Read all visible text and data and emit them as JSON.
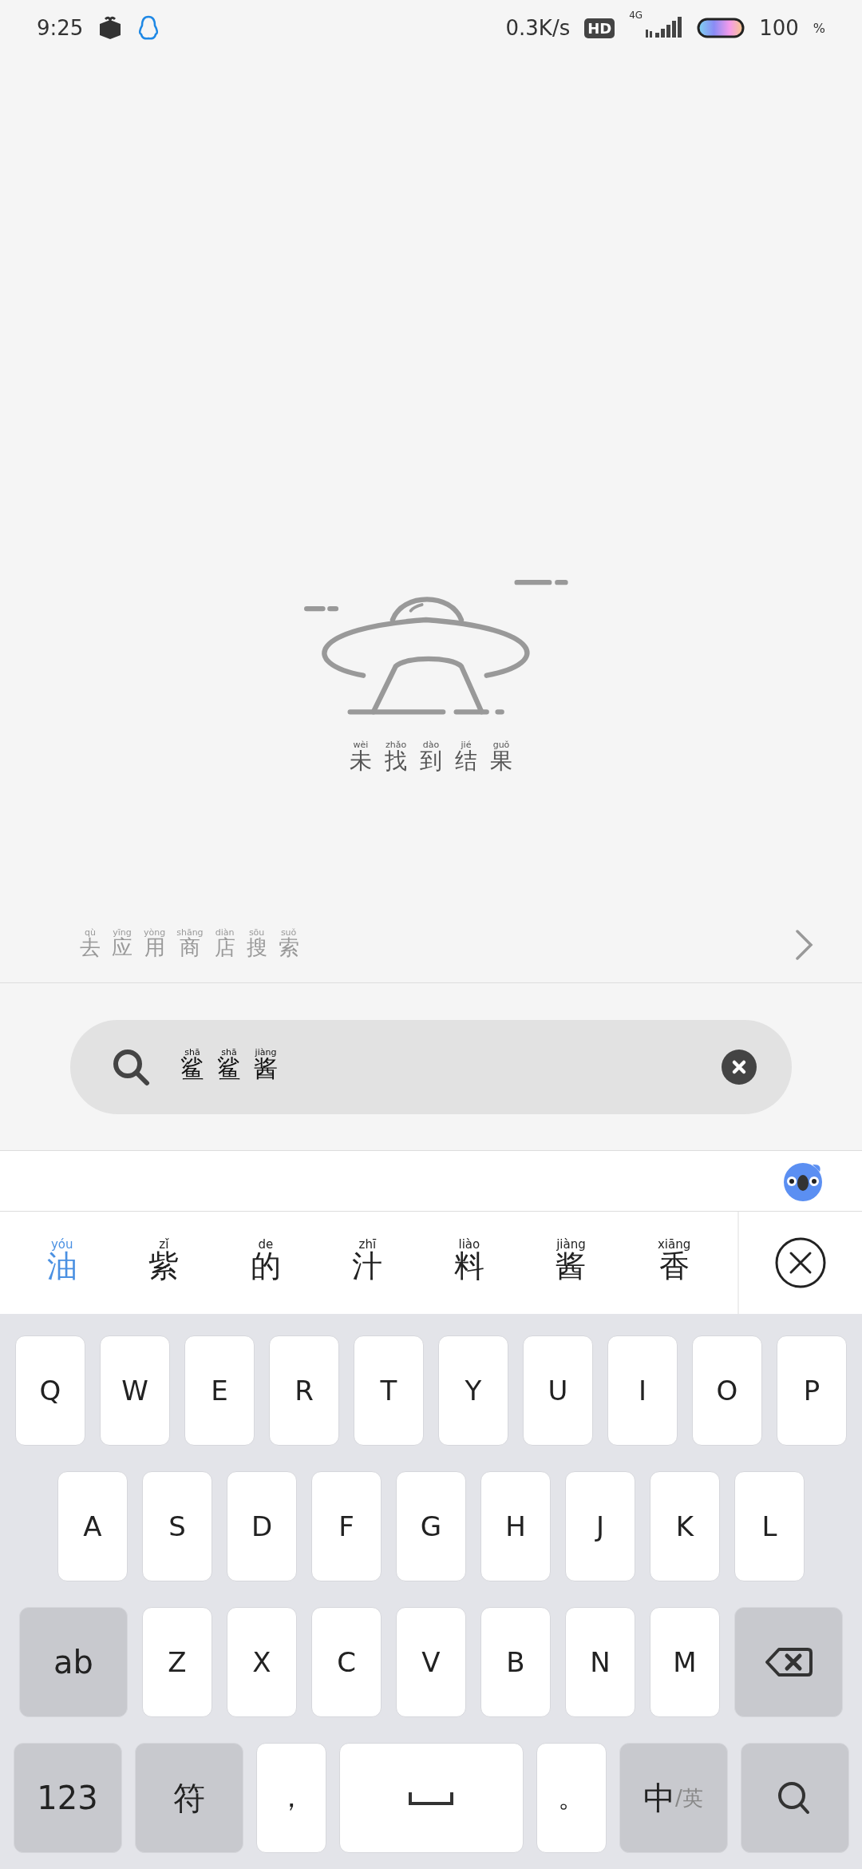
{
  "status_bar": {
    "time": "9:25",
    "speed": "0.3K/s",
    "hd": "HD",
    "network": "4G",
    "battery": "100",
    "percent": "%"
  },
  "empty_state": {
    "message": [
      {
        "char": "未",
        "pinyin": "wèi"
      },
      {
        "char": "找",
        "pinyin": "zhǎo"
      },
      {
        "char": "到",
        "pinyin": "dào"
      },
      {
        "char": "结",
        "pinyin": "jié"
      },
      {
        "char": "果",
        "pinyin": "guǒ"
      }
    ]
  },
  "app_store_link": {
    "label": [
      {
        "char": "去",
        "pinyin": "qù"
      },
      {
        "char": "应",
        "pinyin": "yīng"
      },
      {
        "char": "用",
        "pinyin": "yòng"
      },
      {
        "char": "商",
        "pinyin": "shāng"
      },
      {
        "char": "店",
        "pinyin": "diàn"
      },
      {
        "char": "搜",
        "pinyin": "sōu"
      },
      {
        "char": "索",
        "pinyin": "suǒ"
      }
    ]
  },
  "search": {
    "value": [
      {
        "char": "鲨",
        "pinyin": "shā"
      },
      {
        "char": "鲨",
        "pinyin": "shā"
      },
      {
        "char": "酱",
        "pinyin": "jiàng"
      }
    ]
  },
  "candidates": [
    {
      "char": "油",
      "pinyin": "yóu",
      "selected": true
    },
    {
      "char": "紫",
      "pinyin": "zǐ",
      "selected": false
    },
    {
      "char": "的",
      "pinyin": "de",
      "selected": false
    },
    {
      "char": "汁",
      "pinyin": "zhī",
      "selected": false
    },
    {
      "char": "料",
      "pinyin": "liào",
      "selected": false
    },
    {
      "char": "酱",
      "pinyin": "jiàng",
      "selected": false
    },
    {
      "char": "香",
      "pinyin": "xiāng",
      "selected": false
    }
  ],
  "keyboard": {
    "row_1": [
      {
        "kind": "letter",
        "label": "Q"
      },
      {
        "kind": "letter",
        "label": "W"
      },
      {
        "kind": "letter",
        "label": "E"
      },
      {
        "kind": "letter",
        "label": "R"
      },
      {
        "kind": "letter",
        "label": "T"
      },
      {
        "kind": "letter",
        "label": "Y"
      },
      {
        "kind": "letter",
        "label": "U"
      },
      {
        "kind": "letter",
        "label": "I"
      },
      {
        "kind": "letter",
        "label": "O"
      },
      {
        "kind": "letter",
        "label": "P"
      }
    ],
    "row_2": [
      {
        "kind": "letter",
        "label": "A"
      },
      {
        "kind": "letter",
        "label": "S"
      },
      {
        "kind": "letter",
        "label": "D"
      },
      {
        "kind": "letter",
        "label": "F"
      },
      {
        "kind": "letter",
        "label": "G"
      },
      {
        "kind": "letter",
        "label": "H"
      },
      {
        "kind": "letter",
        "label": "J"
      },
      {
        "kind": "letter",
        "label": "K"
      },
      {
        "kind": "letter",
        "label": "L"
      }
    ],
    "row_3": [
      {
        "kind": "function",
        "label": "ab"
      },
      {
        "kind": "letter",
        "label": "Z"
      },
      {
        "kind": "letter",
        "label": "X"
      },
      {
        "kind": "letter",
        "label": "C"
      },
      {
        "kind": "letter",
        "label": "V"
      },
      {
        "kind": "letter",
        "label": "B"
      },
      {
        "kind": "letter",
        "label": "N"
      },
      {
        "kind": "letter",
        "label": "M"
      },
      {
        "kind": "backspace"
      }
    ],
    "row_4": [
      {
        "kind": "function",
        "label": "123"
      },
      {
        "kind": "function",
        "label": "符"
      },
      {
        "kind": "letter",
        "label": "，"
      },
      {
        "kind": "space"
      },
      {
        "kind": "letter",
        "label": "。"
      },
      {
        "kind": "language",
        "label": "中",
        "sublabel": "/英"
      },
      {
        "kind": "search"
      }
    ]
  }
}
